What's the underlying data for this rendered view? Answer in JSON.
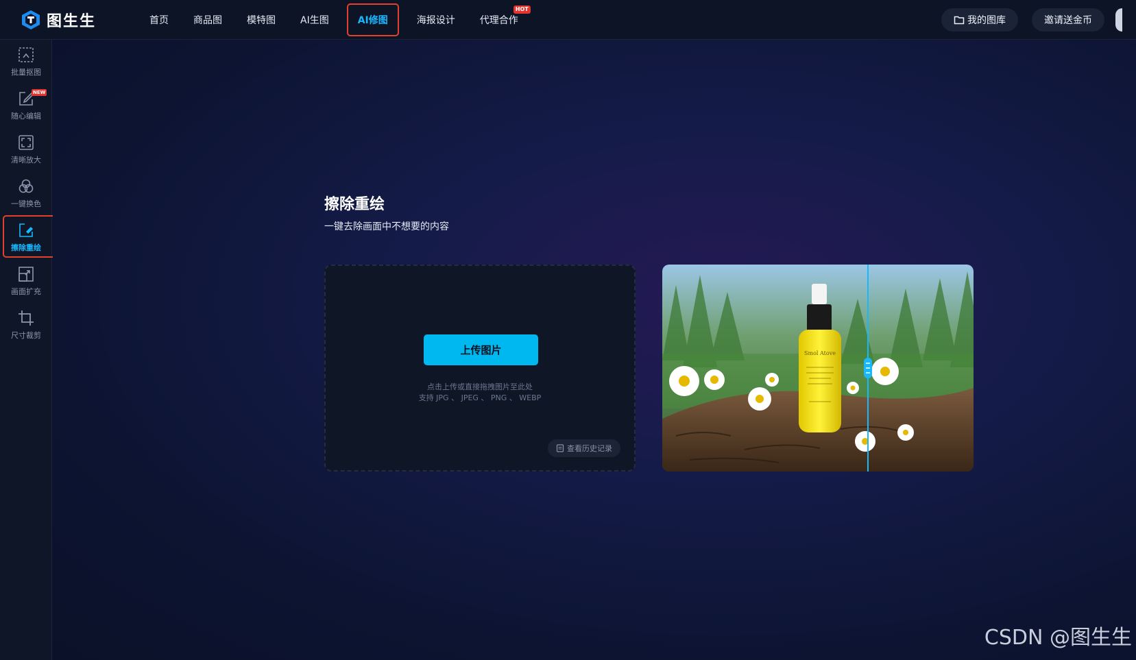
{
  "app": {
    "logo_text": "图生生"
  },
  "nav": [
    {
      "label": "首页"
    },
    {
      "label": "商品图"
    },
    {
      "label": "模特图"
    },
    {
      "label": "AI生图"
    },
    {
      "label": "AI修图",
      "active": true
    },
    {
      "label": "海报设计"
    },
    {
      "label": "代理合作",
      "badge": "HOT"
    }
  ],
  "top_right": {
    "gallery_label": "我的图库",
    "invite_label": "邀请送金币"
  },
  "sidebar": [
    {
      "label": "批量抠图",
      "icon": "batch-cutout-icon"
    },
    {
      "label": "随心编辑",
      "icon": "edit-icon",
      "badge": "NEW"
    },
    {
      "label": "清晰放大",
      "icon": "upscale-icon"
    },
    {
      "label": "一键换色",
      "icon": "recolor-icon"
    },
    {
      "label": "擦除重绘",
      "icon": "eraser-icon",
      "active": true
    },
    {
      "label": "画面扩充",
      "icon": "expand-icon"
    },
    {
      "label": "尺寸裁剪",
      "icon": "crop-icon"
    }
  ],
  "tool": {
    "title": "擦除重绘",
    "subtitle": "一键去除画面中不想要的内容",
    "upload_button": "上传图片",
    "hint_line1": "点击上传或直接拖拽图片至此处",
    "hint_line2": "支持 JPG 、 JPEG 、 PNG 、 WEBP",
    "history_label": "查看历史记录"
  },
  "preview": {
    "bottle_brand": "Smol Atove",
    "compare_position": 0.66,
    "accent": "#18b8ff"
  },
  "watermark": "CSDN @图生生",
  "colors": {
    "accent": "#00b8f0",
    "highlight_border": "#e2412c",
    "badge": "#e3342f"
  }
}
